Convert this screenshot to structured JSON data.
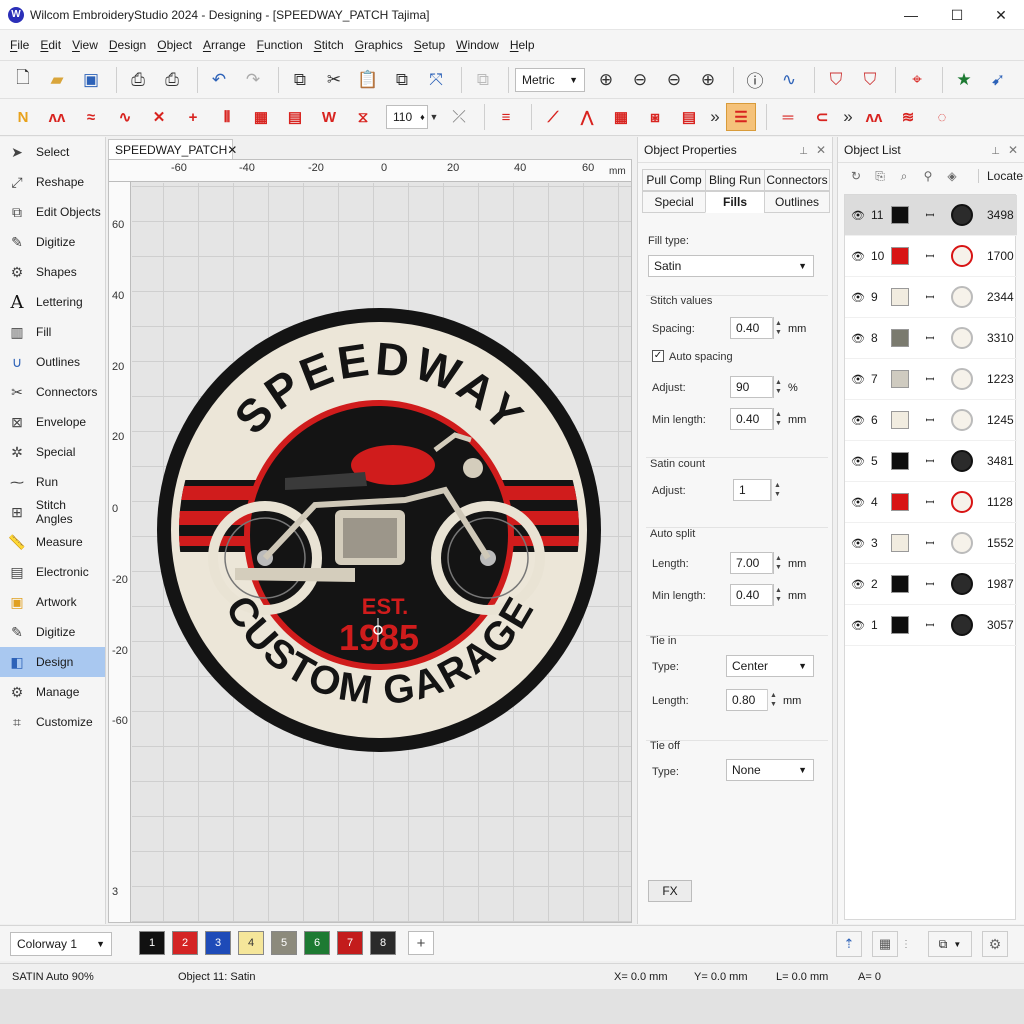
{
  "window": {
    "title": "Wilcom EmbroideryStudio 2024 - Designing - [SPEEDWAY_PATCH       Tajima]",
    "app_icon": "W",
    "minimize": "—",
    "maximize": "☐",
    "close": "✕"
  },
  "menu": [
    "File",
    "Edit",
    "View",
    "Design",
    "Object",
    "Arrange",
    "Function",
    "Stitch",
    "Graphics",
    "Setup",
    "Window",
    "Help"
  ],
  "toolbar": {
    "units": "Metric",
    "stitch_value": "110"
  },
  "left_panel": [
    {
      "label": "Select",
      "icon": "arrow-icon"
    },
    {
      "label": "Reshape",
      "icon": "reshape-icon"
    },
    {
      "label": "Edit Objects",
      "icon": "edit-objects-icon"
    },
    {
      "label": "Digitize",
      "icon": "pen-icon"
    },
    {
      "label": "Shapes",
      "icon": "shapes-icon"
    },
    {
      "label": "Lettering",
      "icon": "letter-a-icon"
    },
    {
      "label": "Fill",
      "icon": "fill-icon"
    },
    {
      "label": "Outlines",
      "icon": "outline-icon"
    },
    {
      "label": "Connectors",
      "icon": "connectors-icon"
    },
    {
      "label": "Envelope",
      "icon": "envelope-icon"
    },
    {
      "label": "Special",
      "icon": "special-icon"
    },
    {
      "label": "Run",
      "icon": "run-icon"
    },
    {
      "label": "Stitch Angles",
      "icon": "stitch-angles-icon"
    },
    {
      "label": "Measure",
      "icon": "measure-icon"
    },
    {
      "label": "Electronic",
      "icon": "electronic-icon"
    },
    {
      "label": "Artwork",
      "icon": "artwork-icon"
    },
    {
      "label": "Digitize",
      "icon": "digitize-icon"
    },
    {
      "label": "Design",
      "icon": "design-icon"
    },
    {
      "label": "Manage",
      "icon": "manage-icon"
    },
    {
      "label": "Customize",
      "icon": "customize-icon"
    }
  ],
  "document": {
    "tab": "SPEEDWAY_PATCH",
    "ruler_top": [
      "-60",
      "-40",
      "-20",
      "0",
      "20",
      "40",
      "60",
      "mm"
    ],
    "ruler_left": [
      "60",
      "40",
      "20",
      "20",
      "0",
      "-20",
      "-20",
      "-40",
      "-60",
      "3"
    ]
  },
  "patch": {
    "top_text": "SPEEDWAY",
    "bottom_text": "CUSTOM GARAGE",
    "est": "EST.",
    "year": "1985"
  },
  "props": {
    "title": "Object Properties",
    "tabs_row1": [
      "Pull Comp",
      "Bling Run",
      "Connectors"
    ],
    "tabs_row2": [
      "Special",
      "Fills",
      "Outlines"
    ],
    "fill_type_label": "Fill type:",
    "fill_type": "Satin",
    "stitch_values_label": "Stitch values",
    "spacing_label": "Spacing:",
    "spacing": "0.40",
    "auto_spacing_label": "Auto spacing",
    "adjust_label": "Adjust:",
    "adjust": "90",
    "min_length_label": "Min length:",
    "min_length": "0.40",
    "satin_count_label": "Satin count",
    "satin_adjust_label": "Adjust:",
    "satin_adjust": "1",
    "auto_split_label": "Auto split",
    "length_label": "Length:",
    "split_length": "7.00",
    "split_min_label": "Min length:",
    "split_min": "0.40",
    "tie_in_label": "Tie in",
    "type_label": "Type:",
    "tie_in_type": "Center",
    "tie_length_label": "Length:",
    "tie_in_length": "0.80",
    "tie_off_label": "Tie off",
    "tie_off_type_label": "Type:",
    "tie_off_type": "None",
    "fx": "FX",
    "mm": "mm",
    "pct": "%"
  },
  "object_list": {
    "title": "Object List",
    "locate": "Locate",
    "rows": [
      {
        "num": "11",
        "color": "#0d0d0d",
        "count": "3498"
      },
      {
        "num": "10",
        "color": "#d81414",
        "count": "1700"
      },
      {
        "num": "9",
        "color": "#f1ece0",
        "count": "2344"
      },
      {
        "num": "8",
        "color": "#7a7a6e",
        "count": "3310"
      },
      {
        "num": "7",
        "color": "#cfcbc0",
        "count": "1223"
      },
      {
        "num": "6",
        "color": "#f1ece0",
        "count": "1245"
      },
      {
        "num": "5",
        "color": "#0d0d0d",
        "count": "3481"
      },
      {
        "num": "4",
        "color": "#d81414",
        "count": "1128"
      },
      {
        "num": "3",
        "color": "#f1ece0",
        "count": "1552"
      },
      {
        "num": "2",
        "color": "#0d0d0d",
        "count": "1987"
      },
      {
        "num": "1",
        "color": "#0d0d0d",
        "count": "3057"
      }
    ]
  },
  "colorway": {
    "name": "Colorway 1",
    "chips": [
      {
        "n": "1",
        "bg": "#111111",
        "fg": "#ffffff"
      },
      {
        "n": "2",
        "bg": "#d42424",
        "fg": "#ffffff"
      },
      {
        "n": "3",
        "bg": "#1e4bb8",
        "fg": "#ffffff"
      },
      {
        "n": "4",
        "bg": "#f5e69a",
        "fg": "#333333"
      },
      {
        "n": "5",
        "bg": "#8c8a7c",
        "fg": "#ffffff"
      },
      {
        "n": "6",
        "bg": "#1d7a32",
        "fg": "#ffffff"
      },
      {
        "n": "7",
        "bg": "#c31c1c",
        "fg": "#ffffff"
      },
      {
        "n": "8",
        "bg": "#2a2a2a",
        "fg": "#ffffff"
      }
    ],
    "add": "+"
  },
  "status": {
    "mode": "SATIN  Auto  90%",
    "object": "Object  11:  Satin",
    "x": "X=   0.0 mm",
    "y": "Y=   0.0 mm",
    "l": "L=   0.0 mm",
    "a": "A=   0"
  }
}
